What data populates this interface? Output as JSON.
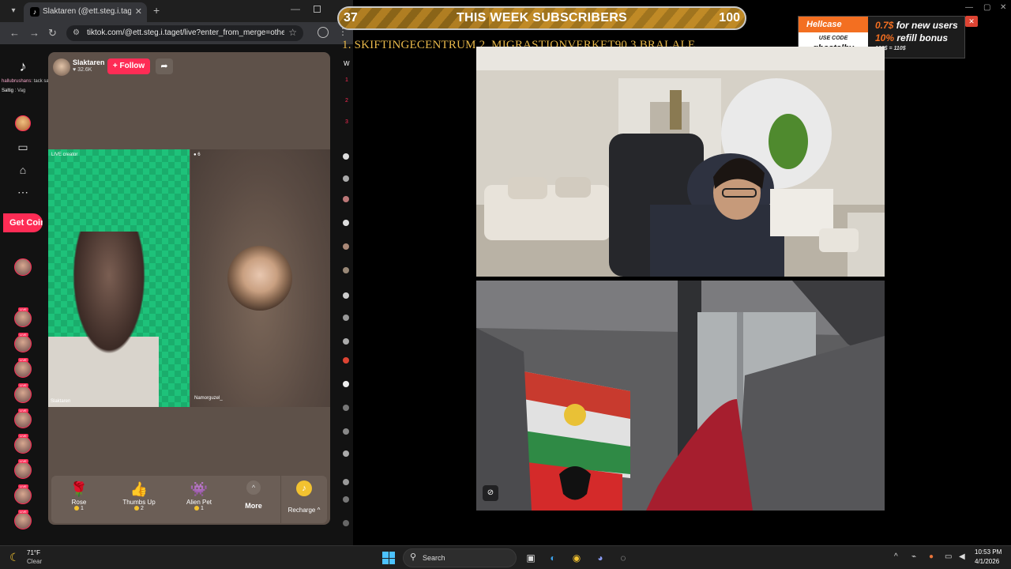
{
  "browser": {
    "tab_title": "Slaktaren (@ett.steg.i.taget)",
    "tab_close": "✕",
    "new_tab": "+",
    "address": "tiktok.com/@ett.steg.i.taget/live?enter_from_merge=others...",
    "favicon_glyph": "♪"
  },
  "tiktok": {
    "chat": [
      {
        "user": "hallubrushans",
        "text": ": tack salt"
      },
      {
        "user": "Saltig",
        "text": " : Vag"
      }
    ],
    "get_coins": "Get Coins",
    "host": {
      "name": "Slaktaren",
      "likes": "32.6K"
    },
    "follow_label": "+ Follow",
    "share_glyph": "➦",
    "video_left": {
      "badge": "LIVE creator",
      "name": "Slaktaren"
    },
    "video_right": {
      "badge": "6",
      "name": "Namorguzel_"
    },
    "gifts": [
      {
        "name": "Rose",
        "cost": "1",
        "icon": "🌹"
      },
      {
        "name": "Thumbs Up",
        "cost": "2",
        "icon": "👍"
      },
      {
        "name": "Alien Pet",
        "cost": "1",
        "icon": "👾"
      }
    ],
    "more_label": "More",
    "more_glyph": "^",
    "recharge_label": "Recharge ^",
    "recharge_glyph": "♪",
    "side_strip": [
      "W",
      "1",
      "2",
      "3"
    ]
  },
  "overlay": {
    "subs_current": "37",
    "subs_title": "THIS WEEK SUBSCRIBERS",
    "subs_goal": "100",
    "subs_progress": 0.37,
    "ticker": "1. SKIFTINGECENTRUM  2. MIGRASTIONVERKET90 3.BRALALE",
    "promo": {
      "brand": "Hellcase",
      "use_code": "USE CODE",
      "code": "ghostalby",
      "line1_value": "0.7$",
      "line1_text": " for new users",
      "line2_value": "10%",
      "line2_text": " refill bonus",
      "line3": "100$ = 110$",
      "close_glyph": "✕"
    }
  },
  "taskbar": {
    "weather_temp": "71°F",
    "weather_cond": "Clear",
    "search_label": "Search",
    "time": "10:53 PM",
    "date": "4/1/2026"
  },
  "colors": {
    "tiktok_red": "#fe2c55",
    "ticker_gold": "#e8b84a",
    "hellcase_orange": "#f36f21",
    "green_screen": "#1ec27a"
  }
}
